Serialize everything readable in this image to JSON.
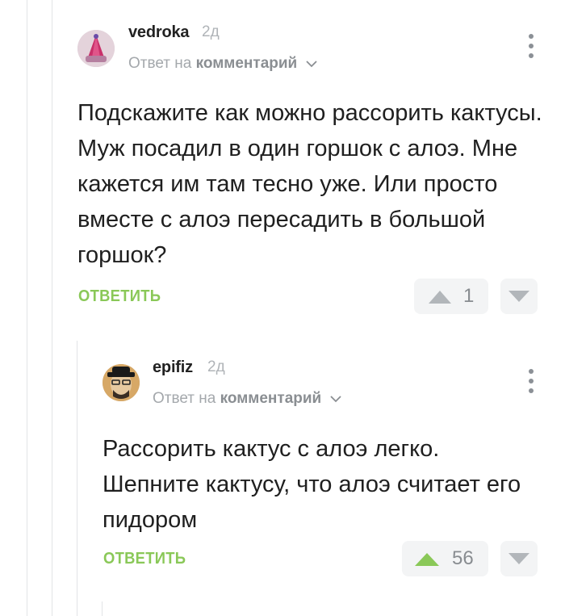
{
  "comments": [
    {
      "username": "vedroka",
      "time": "2д",
      "reply_prefix": "Ответ на",
      "reply_link": "комментарий",
      "text": "Подскажите как можно рассорить кактусы. Муж посадил в один горшок с алоэ. Мне кажется им там тесно уже. Или просто вместе с алоэ пересадить в большой горшок?",
      "reply_label": "ОТВЕТИТЬ",
      "rating": "1",
      "voted_up": false
    },
    {
      "username": "epifiz",
      "time": "2д",
      "reply_prefix": "Ответ на",
      "reply_link": "комментарий",
      "text": "Рассорить кактус с алоэ легко. Шепните кактусу, что алоэ считает его пидором",
      "reply_label": "ОТВЕТИТЬ",
      "rating": "56",
      "voted_up": true
    }
  ],
  "icons": {
    "menu": "more-vertical-icon",
    "upvote": "triangle-up-icon",
    "downvote": "triangle-down-icon",
    "expand": "chevron-down-icon"
  },
  "colors": {
    "accent_green": "#8ac858",
    "muted_gray": "#b2b6ba",
    "vote_bg": "#f3f4f5"
  }
}
